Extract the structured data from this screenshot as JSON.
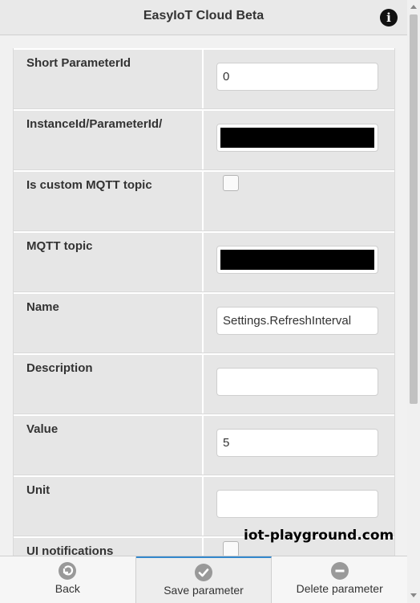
{
  "header": {
    "title": "EasyIoT Cloud Beta",
    "info_icon": "i"
  },
  "fields": {
    "short_parameter_id": {
      "label": "Short ParameterId",
      "value": "0"
    },
    "instance_parameter_id": {
      "label": "InstanceId/ParameterId/"
    },
    "is_custom_mqtt": {
      "label": "Is custom MQTT topic"
    },
    "mqtt_topic": {
      "label": "MQTT topic"
    },
    "name": {
      "label": "Name",
      "value": "Settings.RefreshInterval"
    },
    "description": {
      "label": "Description",
      "value": ""
    },
    "value": {
      "label": "Value",
      "value": "5"
    },
    "unit": {
      "label": "Unit",
      "value": ""
    },
    "ui_notifications": {
      "label": "UI notifications"
    }
  },
  "watermark": "iot-playground.com",
  "footer": {
    "back_label": "Back",
    "save_label": "Save parameter",
    "delete_label": "Delete parameter"
  }
}
